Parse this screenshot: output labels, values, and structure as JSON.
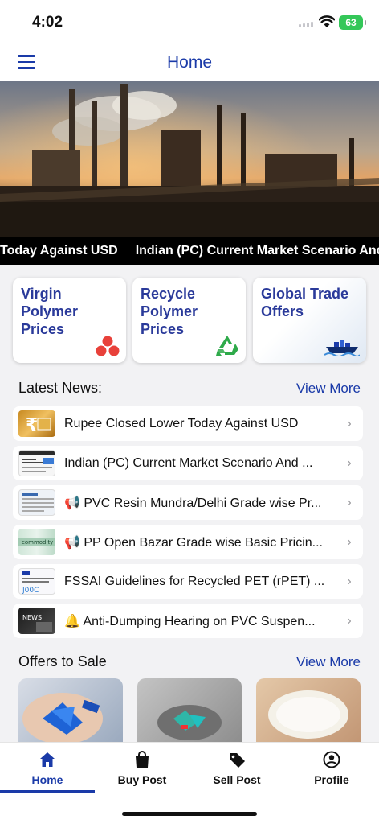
{
  "status": {
    "time": "4:02",
    "battery": "63"
  },
  "header": {
    "title": "Home",
    "menu_icon": "hamburger-icon"
  },
  "ticker": {
    "items": [
      "Today Against USD",
      "Indian (PC) Current Market Scenario And"
    ]
  },
  "categories": [
    {
      "label": "Virgin Polymer Prices",
      "icon": "three-dots-icon",
      "color": "#e8413a"
    },
    {
      "label": "Recycle Polymer Prices",
      "icon": "recycle-icon",
      "color": "#2eaa4a"
    },
    {
      "label": "Global Trade Offers",
      "icon": "cargo-ship-icon",
      "color": "#1a3aa8"
    }
  ],
  "latest_news": {
    "heading": "Latest News:",
    "view_more": "View More",
    "items": [
      {
        "title": "Rupee Closed Lower Today Against USD"
      },
      {
        "title": "Indian (PC) Current Market Scenario And ..."
      },
      {
        "title": "📢 PVC Resin Mundra/Delhi Grade wise Pr..."
      },
      {
        "title": "📢 PP Open Bazar Grade wise Basic Pricin..."
      },
      {
        "title": "FSSAI Guidelines for Recycled PET (rPET) ..."
      },
      {
        "title": "🔔 Anti-Dumping Hearing on PVC Suspen..."
      }
    ]
  },
  "offers": {
    "heading": "Offers to Sale",
    "view_more": "View More"
  },
  "tabs": [
    {
      "label": "Home",
      "icon": "home-icon",
      "active": true
    },
    {
      "label": "Buy Post",
      "icon": "shopping-bag-icon",
      "active": false
    },
    {
      "label": "Sell Post",
      "icon": "tag-icon",
      "active": false
    },
    {
      "label": "Profile",
      "icon": "profile-icon",
      "active": false
    }
  ],
  "colors": {
    "accent": "#1a3aa8",
    "card_text": "#2a3a9a"
  }
}
